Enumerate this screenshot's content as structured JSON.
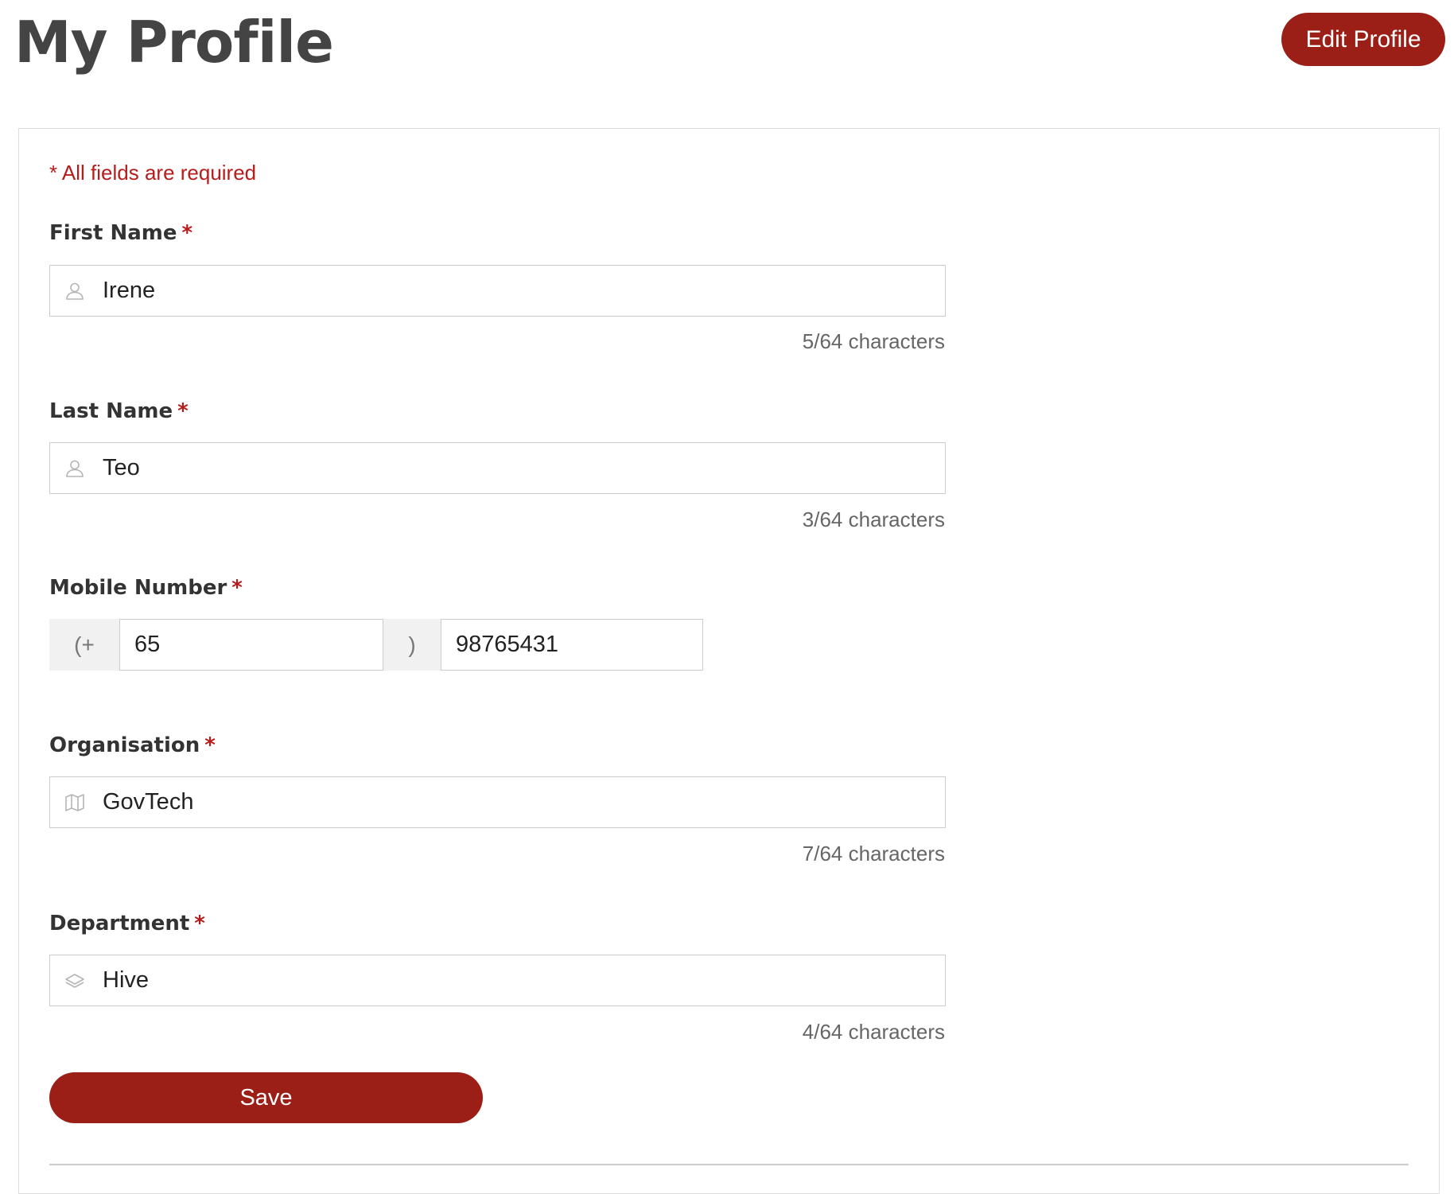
{
  "header": {
    "title": "My Profile",
    "edit_button": "Edit Profile"
  },
  "form": {
    "required_note": "* All fields are required",
    "required_star": "*",
    "first_name": {
      "label": "First Name",
      "value": "Irene",
      "counter": "5/64 characters",
      "icon": "user-icon"
    },
    "last_name": {
      "label": "Last Name",
      "value": "Teo",
      "counter": "3/64 characters",
      "icon": "user-icon"
    },
    "mobile": {
      "label": "Mobile Number",
      "prefix": "(+",
      "country_code": "65",
      "separator": ")",
      "number": "98765431"
    },
    "organisation": {
      "label": "Organisation",
      "value": "GovTech",
      "counter": "7/64 characters",
      "icon": "map-icon"
    },
    "department": {
      "label": "Department",
      "value": "Hive",
      "counter": "4/64 characters",
      "icon": "layers-icon"
    },
    "save_button": "Save"
  },
  "colors": {
    "primary": "#9b1f16",
    "required": "#b71c1c",
    "text": "#333333",
    "muted": "#666666",
    "border": "#cccccc",
    "addon_bg": "#f1f1f1"
  }
}
